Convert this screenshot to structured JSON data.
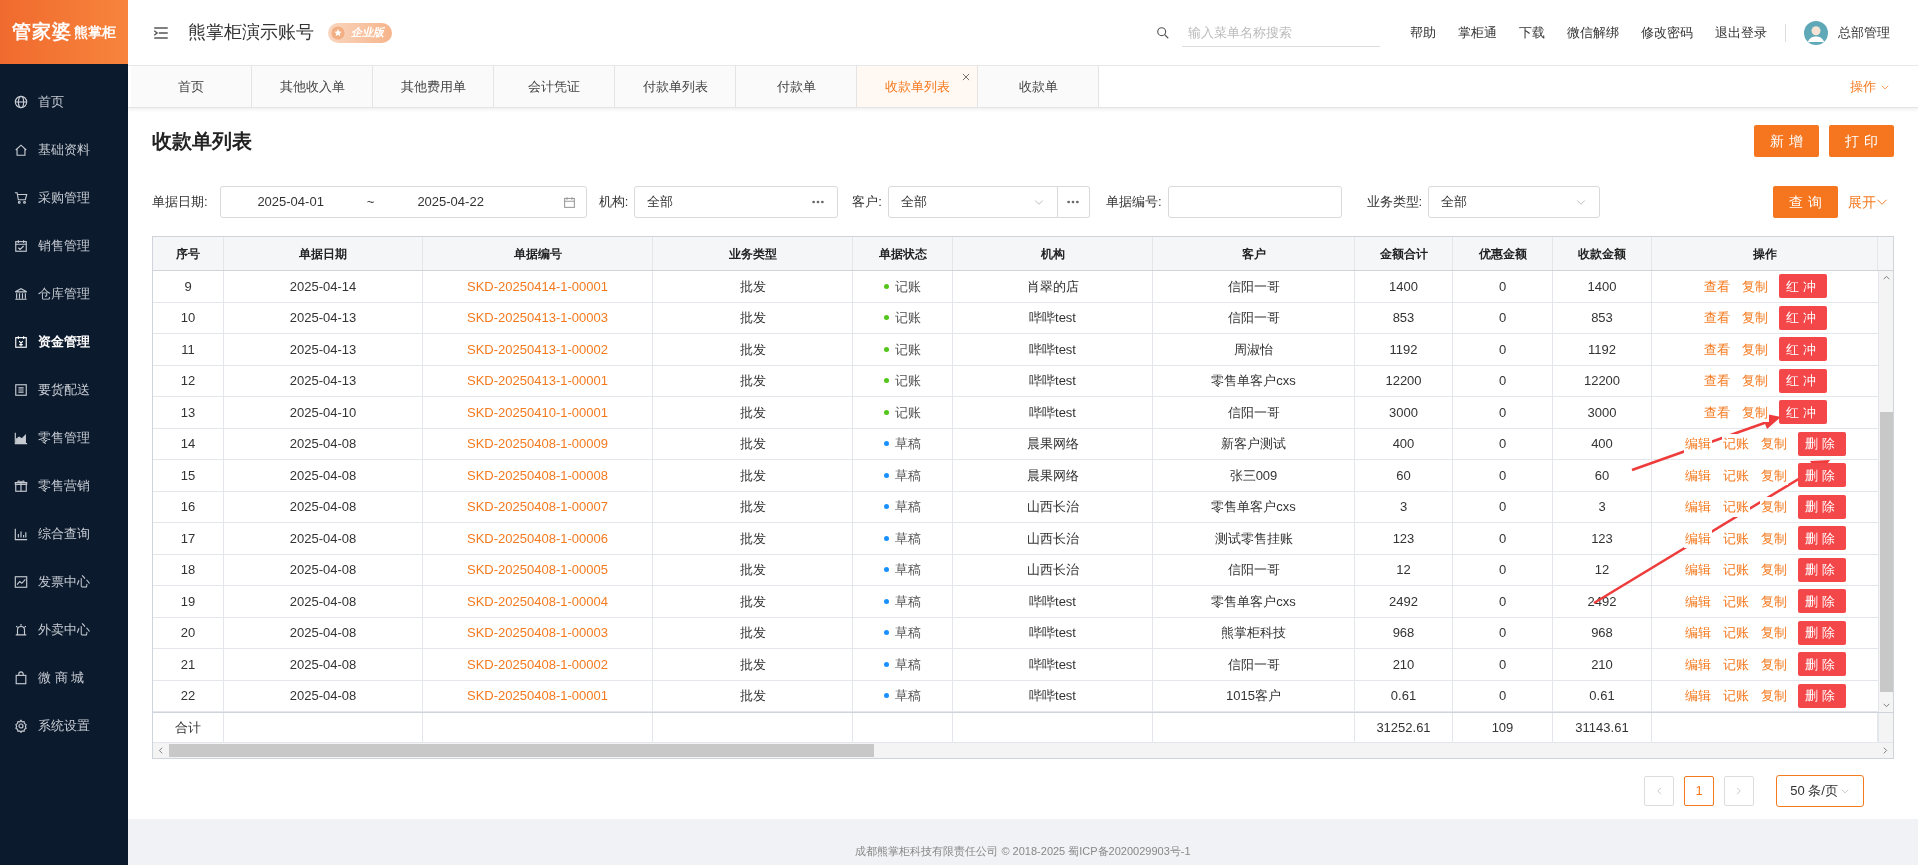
{
  "logo": {
    "brand": "管家婆",
    "product": "熊掌柜"
  },
  "sidebar": {
    "items": [
      {
        "label": "首页",
        "selected": false
      },
      {
        "label": "基础资料",
        "selected": false
      },
      {
        "label": "采购管理",
        "selected": false
      },
      {
        "label": "销售管理",
        "selected": false
      },
      {
        "label": "仓库管理",
        "selected": false
      },
      {
        "label": "资金管理",
        "selected": true
      },
      {
        "label": "要货配送",
        "selected": false
      },
      {
        "label": "零售管理",
        "selected": false
      },
      {
        "label": "零售营销",
        "selected": false
      },
      {
        "label": "综合查询",
        "selected": false
      },
      {
        "label": "发票中心",
        "selected": false
      },
      {
        "label": "外卖中心",
        "selected": false
      },
      {
        "label": "微 商 城",
        "selected": false
      },
      {
        "label": "系统设置",
        "selected": false
      }
    ]
  },
  "header": {
    "account": "熊掌柜演示账号",
    "edition": "企业版",
    "search": {
      "placeholder": "输入菜单名称搜索"
    },
    "links": [
      "帮助",
      "掌柜通",
      "下载",
      "微信解绑",
      "修改密码",
      "退出登录"
    ],
    "user": "总部管理"
  },
  "tabs": [
    {
      "label": "首页",
      "selected": false,
      "closable": false
    },
    {
      "label": "其他收入单",
      "selected": false,
      "closable": false
    },
    {
      "label": "其他费用单",
      "selected": false,
      "closable": false
    },
    {
      "label": "会计凭证",
      "selected": false,
      "closable": false
    },
    {
      "label": "付款单列表",
      "selected": false,
      "closable": false
    },
    {
      "label": "付款单",
      "selected": false,
      "closable": false
    },
    {
      "label": "收款单列表",
      "selected": true,
      "closable": true
    },
    {
      "label": "收款单",
      "selected": false,
      "closable": false
    }
  ],
  "tab_menu": "操作",
  "page": {
    "title": "收款单列表",
    "buttons": [
      "新增",
      "打印"
    ]
  },
  "filters": {
    "date_label": "单据日期:",
    "date_from": "2025-04-01",
    "date_sep": "~",
    "date_to": "2025-04-22",
    "org_label": "机构:",
    "org_value": "全部",
    "customer_label": "客户:",
    "customer_value": "全部",
    "number_label": "单据编号:",
    "type_label": "业务类型:",
    "type_value": "全部",
    "query_button": "查询",
    "expand_link": "展开"
  },
  "table": {
    "columns": [
      "序号",
      "单据日期",
      "单据编号",
      "业务类型",
      "单据状态",
      "机构",
      "客户",
      "金额合计",
      "优惠金额",
      "收款金额",
      "操作"
    ],
    "rows": [
      {
        "no": "9",
        "date": "2025-04-14",
        "number": "SKD-20250414-1-00001",
        "type": "批发",
        "status": {
          "label": "记账",
          "color": "#52c41a"
        },
        "org": "肖翠的店",
        "customer": "信阳一哥",
        "total": "1400",
        "discount": "0",
        "received": "1400",
        "actions": [
          {
            "label": "查看",
            "kind": "link"
          },
          {
            "label": "复制",
            "kind": "link"
          },
          {
            "label": "红冲",
            "kind": "button"
          }
        ]
      },
      {
        "no": "10",
        "date": "2025-04-13",
        "number": "SKD-20250413-1-00003",
        "type": "批发",
        "status": {
          "label": "记账",
          "color": "#52c41a"
        },
        "org": "哔哔test",
        "customer": "信阳一哥",
        "total": "853",
        "discount": "0",
        "received": "853",
        "actions": [
          {
            "label": "查看",
            "kind": "link"
          },
          {
            "label": "复制",
            "kind": "link"
          },
          {
            "label": "红冲",
            "kind": "button"
          }
        ]
      },
      {
        "no": "11",
        "date": "2025-04-13",
        "number": "SKD-20250413-1-00002",
        "type": "批发",
        "status": {
          "label": "记账",
          "color": "#52c41a"
        },
        "org": "哔哔test",
        "customer": "周淑怡",
        "total": "1192",
        "discount": "0",
        "received": "1192",
        "actions": [
          {
            "label": "查看",
            "kind": "link"
          },
          {
            "label": "复制",
            "kind": "link"
          },
          {
            "label": "红冲",
            "kind": "button"
          }
        ]
      },
      {
        "no": "12",
        "date": "2025-04-13",
        "number": "SKD-20250413-1-00001",
        "type": "批发",
        "status": {
          "label": "记账",
          "color": "#52c41a"
        },
        "org": "哔哔test",
        "customer": "零售单客户cxs",
        "total": "12200",
        "discount": "0",
        "received": "12200",
        "actions": [
          {
            "label": "查看",
            "kind": "link"
          },
          {
            "label": "复制",
            "kind": "link"
          },
          {
            "label": "红冲",
            "kind": "button"
          }
        ]
      },
      {
        "no": "13",
        "date": "2025-04-10",
        "number": "SKD-20250410-1-00001",
        "type": "批发",
        "status": {
          "label": "记账",
          "color": "#52c41a"
        },
        "org": "哔哔test",
        "customer": "信阳一哥",
        "total": "3000",
        "discount": "0",
        "received": "3000",
        "actions": [
          {
            "label": "查看",
            "kind": "link"
          },
          {
            "label": "复制",
            "kind": "link"
          },
          {
            "label": "红冲",
            "kind": "button"
          }
        ]
      },
      {
        "no": "14",
        "date": "2025-04-08",
        "number": "SKD-20250408-1-00009",
        "type": "批发",
        "status": {
          "label": "草稿",
          "color": "#1890ff"
        },
        "org": "晨果网络",
        "customer": "新客户测试",
        "total": "400",
        "discount": "0",
        "received": "400",
        "actions": [
          {
            "label": "编辑",
            "kind": "link"
          },
          {
            "label": "记账",
            "kind": "link"
          },
          {
            "label": "复制",
            "kind": "link"
          },
          {
            "label": "删除",
            "kind": "button"
          }
        ]
      },
      {
        "no": "15",
        "date": "2025-04-08",
        "number": "SKD-20250408-1-00008",
        "type": "批发",
        "status": {
          "label": "草稿",
          "color": "#1890ff"
        },
        "org": "晨果网络",
        "customer": "张三009",
        "total": "60",
        "discount": "0",
        "received": "60",
        "actions": [
          {
            "label": "编辑",
            "kind": "link"
          },
          {
            "label": "记账",
            "kind": "link"
          },
          {
            "label": "复制",
            "kind": "link"
          },
          {
            "label": "删除",
            "kind": "button"
          }
        ]
      },
      {
        "no": "16",
        "date": "2025-04-08",
        "number": "SKD-20250408-1-00007",
        "type": "批发",
        "status": {
          "label": "草稿",
          "color": "#1890ff"
        },
        "org": "山西长治",
        "customer": "零售单客户cxs",
        "total": "3",
        "discount": "0",
        "received": "3",
        "actions": [
          {
            "label": "编辑",
            "kind": "link"
          },
          {
            "label": "记账",
            "kind": "link"
          },
          {
            "label": "复制",
            "kind": "link"
          },
          {
            "label": "删除",
            "kind": "button"
          }
        ]
      },
      {
        "no": "17",
        "date": "2025-04-08",
        "number": "SKD-20250408-1-00006",
        "type": "批发",
        "status": {
          "label": "草稿",
          "color": "#1890ff"
        },
        "org": "山西长治",
        "customer": "测试零售挂账",
        "total": "123",
        "discount": "0",
        "received": "123",
        "actions": [
          {
            "label": "编辑",
            "kind": "link"
          },
          {
            "label": "记账",
            "kind": "link"
          },
          {
            "label": "复制",
            "kind": "link"
          },
          {
            "label": "删除",
            "kind": "button"
          }
        ]
      },
      {
        "no": "18",
        "date": "2025-04-08",
        "number": "SKD-20250408-1-00005",
        "type": "批发",
        "status": {
          "label": "草稿",
          "color": "#1890ff"
        },
        "org": "山西长治",
        "customer": "信阳一哥",
        "total": "12",
        "discount": "0",
        "received": "12",
        "actions": [
          {
            "label": "编辑",
            "kind": "link"
          },
          {
            "label": "记账",
            "kind": "link"
          },
          {
            "label": "复制",
            "kind": "link"
          },
          {
            "label": "删除",
            "kind": "button"
          }
        ]
      },
      {
        "no": "19",
        "date": "2025-04-08",
        "number": "SKD-20250408-1-00004",
        "type": "批发",
        "status": {
          "label": "草稿",
          "color": "#1890ff"
        },
        "org": "哔哔test",
        "customer": "零售单客户cxs",
        "total": "2492",
        "discount": "0",
        "received": "2492",
        "actions": [
          {
            "label": "编辑",
            "kind": "link"
          },
          {
            "label": "记账",
            "kind": "link"
          },
          {
            "label": "复制",
            "kind": "link"
          },
          {
            "label": "删除",
            "kind": "button"
          }
        ]
      },
      {
        "no": "20",
        "date": "2025-04-08",
        "number": "SKD-20250408-1-00003",
        "type": "批发",
        "status": {
          "label": "草稿",
          "color": "#1890ff"
        },
        "org": "哔哔test",
        "customer": "熊掌柜科技",
        "total": "968",
        "discount": "0",
        "received": "968",
        "actions": [
          {
            "label": "编辑",
            "kind": "link"
          },
          {
            "label": "记账",
            "kind": "link"
          },
          {
            "label": "复制",
            "kind": "link"
          },
          {
            "label": "删除",
            "kind": "button"
          }
        ]
      },
      {
        "no": "21",
        "date": "2025-04-08",
        "number": "SKD-20250408-1-00002",
        "type": "批发",
        "status": {
          "label": "草稿",
          "color": "#1890ff"
        },
        "org": "哔哔test",
        "customer": "信阳一哥",
        "total": "210",
        "discount": "0",
        "received": "210",
        "actions": [
          {
            "label": "编辑",
            "kind": "link"
          },
          {
            "label": "记账",
            "kind": "link"
          },
          {
            "label": "复制",
            "kind": "link"
          },
          {
            "label": "删除",
            "kind": "button"
          }
        ]
      },
      {
        "no": "22",
        "date": "2025-04-08",
        "number": "SKD-20250408-1-00001",
        "type": "批发",
        "status": {
          "label": "草稿",
          "color": "#1890ff"
        },
        "org": "哔哔test",
        "customer": "1015客户",
        "total": "0.61",
        "discount": "0",
        "received": "0.61",
        "actions": [
          {
            "label": "编辑",
            "kind": "link"
          },
          {
            "label": "记账",
            "kind": "link"
          },
          {
            "label": "复制",
            "kind": "link"
          },
          {
            "label": "删除",
            "kind": "button"
          }
        ]
      }
    ],
    "summary": {
      "label": "合计",
      "total": "31252.61",
      "discount": "109",
      "received": "31143.61"
    }
  },
  "pagination": {
    "pages": [
      {
        "label": "1",
        "selected": true
      }
    ],
    "page_size": "50 条/页"
  },
  "footer": "成都熊掌柜科技有限责任公司 © 2018-2025 蜀ICP备2020029903号-1"
}
